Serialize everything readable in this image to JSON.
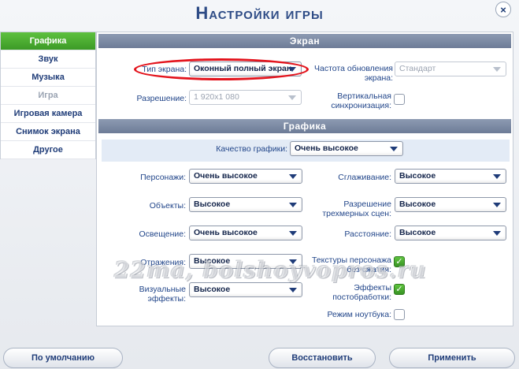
{
  "title": "Настройки игры",
  "close_label": "×",
  "sidebar": {
    "items": [
      {
        "label": "Графика"
      },
      {
        "label": "Звук"
      },
      {
        "label": "Музыка"
      },
      {
        "label": "Игра"
      },
      {
        "label": "Игровая камера"
      },
      {
        "label": "Снимок экрана"
      },
      {
        "label": "Другое"
      }
    ],
    "active": "Графика",
    "disabled": "Игра"
  },
  "screen": {
    "header": "Экран",
    "screen_type_label": "Тип экрана:",
    "screen_type_value": "Оконный полный экран",
    "refresh_label": "Частота обновления экрана:",
    "refresh_value": "Стандарт",
    "resolution_label": "Разрешение:",
    "resolution_value": "1 920x1 080",
    "vsync_label": "Вертикальная синхронизация:",
    "vsync_checked": false
  },
  "graphics": {
    "header": "Графика",
    "quality_label": "Качество графики:",
    "quality_value": "Очень высокое",
    "characters_label": "Персонажи:",
    "characters_value": "Очень высокое",
    "antialias_label": "Сглаживание:",
    "antialias_value": "Высокое",
    "objects_label": "Объекты:",
    "objects_value": "Высокое",
    "res3d_label": "Разрешение трехмерных сцен:",
    "res3d_value": "Высокое",
    "lighting_label": "Освещение:",
    "lighting_value": "Очень высокое",
    "distance_label": "Расстояние:",
    "distance_value": "Высокое",
    "reflections_label": "Отражения:",
    "reflections_value": "Высокое",
    "textures_label": "Текстуры персонажа без сжатия:",
    "textures_checked": true,
    "visual_label": "Визуальные эффекты:",
    "visual_value": "Высокое",
    "post_label": "Эффекты постобработки:",
    "post_checked": true,
    "laptop_label": "Режим ноутбука:",
    "laptop_checked": false
  },
  "watermark": "22ma, bolshoyvopros.ru",
  "buttons": {
    "defaults": "По умолчанию",
    "restore": "Восстановить",
    "apply": "Применить"
  },
  "colors": {
    "accent_green": "#4caf32",
    "highlight_red": "#e3141d",
    "text_blue": "#1f3c78"
  }
}
